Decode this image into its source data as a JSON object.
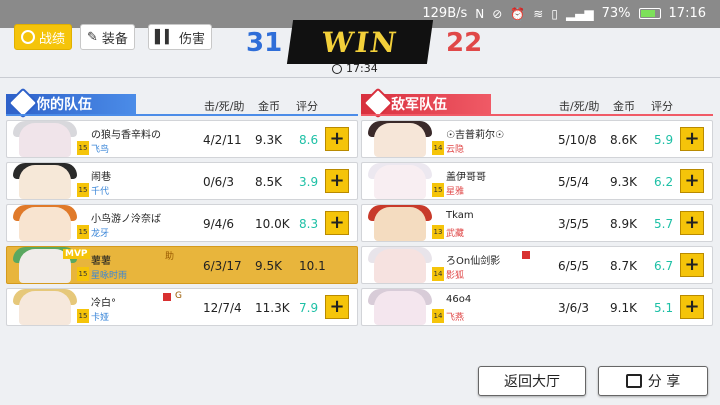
{
  "statusbar": {
    "speed": "129B/s",
    "battery_pct": "73%",
    "time": "17:16"
  },
  "header": {
    "tabs": [
      "战绩",
      "装备",
      "伤害"
    ],
    "logo_text": "WIN",
    "score_blue": "31",
    "score_red": "22",
    "match_time": "17:34"
  },
  "columns": {
    "kda": "击/死/助",
    "gold": "金币",
    "rating": "评分"
  },
  "left_team": {
    "title": "你的队伍",
    "players": [
      {
        "name": "の狼与香辛料の",
        "hero": "飞鸟",
        "level": "15",
        "kda": "4/2/11",
        "gold": "9.3K",
        "rating": "8.6"
      },
      {
        "name": "闹巷",
        "hero": "千代",
        "level": "15",
        "kda": "0/6/3",
        "gold": "8.5K",
        "rating": "3.9"
      },
      {
        "name": "小鸟游ノ泠奈ば",
        "hero": "龙牙",
        "level": "15",
        "kda": "9/4/6",
        "gold": "10.0K",
        "rating": "8.3"
      },
      {
        "name": "薯薯",
        "hero": "星咏时雨",
        "level": "15",
        "kda": "6/3/17",
        "gold": "9.5K",
        "rating": "10.1",
        "mvp": "MVP",
        "tag": "助"
      },
      {
        "name": "冷白°",
        "hero": "卡娅",
        "level": "15",
        "kda": "12/7/4",
        "gold": "11.3K",
        "rating": "7.9",
        "tag": "G"
      }
    ]
  },
  "right_team": {
    "title": "敌军队伍",
    "players": [
      {
        "name": "☉吉普莉尔☉",
        "hero": "云隐",
        "level": "14",
        "kda": "5/10/8",
        "gold": "8.6K",
        "rating": "5.9"
      },
      {
        "name": "盖伊哥哥",
        "hero": "星雅",
        "level": "15",
        "kda": "5/5/4",
        "gold": "9.3K",
        "rating": "6.2"
      },
      {
        "name": "Tkam",
        "hero": "武藏",
        "level": "13",
        "kda": "3/5/5",
        "gold": "8.9K",
        "rating": "5.7"
      },
      {
        "name": "ろOn仙剑影",
        "hero": "影狐",
        "level": "14",
        "kda": "6/5/5",
        "gold": "8.7K",
        "rating": "6.7"
      },
      {
        "name": "46o4",
        "hero": "飞燕",
        "level": "14",
        "kda": "3/6/3",
        "gold": "9.1K",
        "rating": "5.1"
      }
    ]
  },
  "footer": {
    "back_label": "返回大厅",
    "share_label": "分 享"
  },
  "colors": {
    "blue": "#2f6ed8",
    "red": "#e04848",
    "gold": "#f5c40a",
    "rating": "#1ec0a6"
  }
}
